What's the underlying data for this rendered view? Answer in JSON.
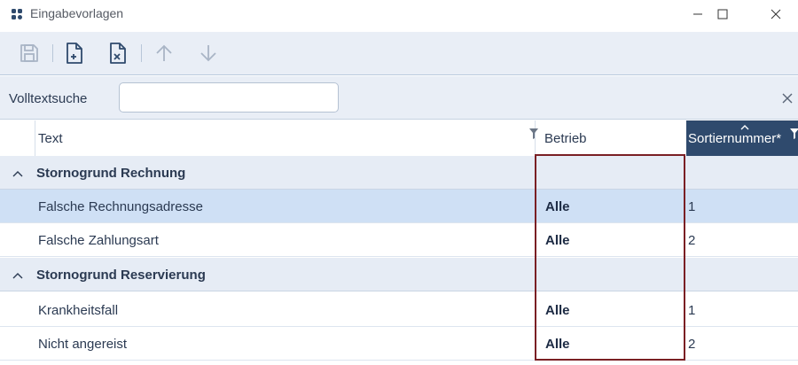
{
  "window": {
    "title": "Eingabevorlagen"
  },
  "toolbar": {
    "buttons": [
      {
        "name": "save",
        "icon": "save-icon"
      },
      {
        "name": "new",
        "icon": "new-document-icon"
      },
      {
        "name": "delete",
        "icon": "delete-document-icon"
      },
      {
        "name": "move-up",
        "icon": "arrow-up-icon"
      },
      {
        "name": "move-down",
        "icon": "arrow-down-icon"
      }
    ]
  },
  "search": {
    "label": "Volltextsuche",
    "value": "",
    "placeholder": ""
  },
  "grid": {
    "columns": {
      "text": "Text",
      "betrieb": "Betrieb",
      "sortiernummer": "Sortiernummer*"
    },
    "groups": [
      {
        "label": "Stornogrund Rechnung",
        "rows": [
          {
            "text": "Falsche Rechnungsadresse",
            "betrieb": "Alle",
            "sort": "1",
            "selected": true
          },
          {
            "text": "Falsche Zahlungsart",
            "betrieb": "Alle",
            "sort": "2",
            "selected": false
          }
        ]
      },
      {
        "label": "Stornogrund Reservierung",
        "rows": [
          {
            "text": "Krankheitsfall",
            "betrieb": "Alle",
            "sort": "1",
            "selected": false
          },
          {
            "text": "Nicht angereist",
            "betrieb": "Alle",
            "sort": "2",
            "selected": false
          }
        ]
      }
    ]
  },
  "colors": {
    "accent_header": "#2f4a6d",
    "selection": "#cfe0f5",
    "group_band": "#e6ecf5",
    "highlight_box": "#7a1f24"
  }
}
